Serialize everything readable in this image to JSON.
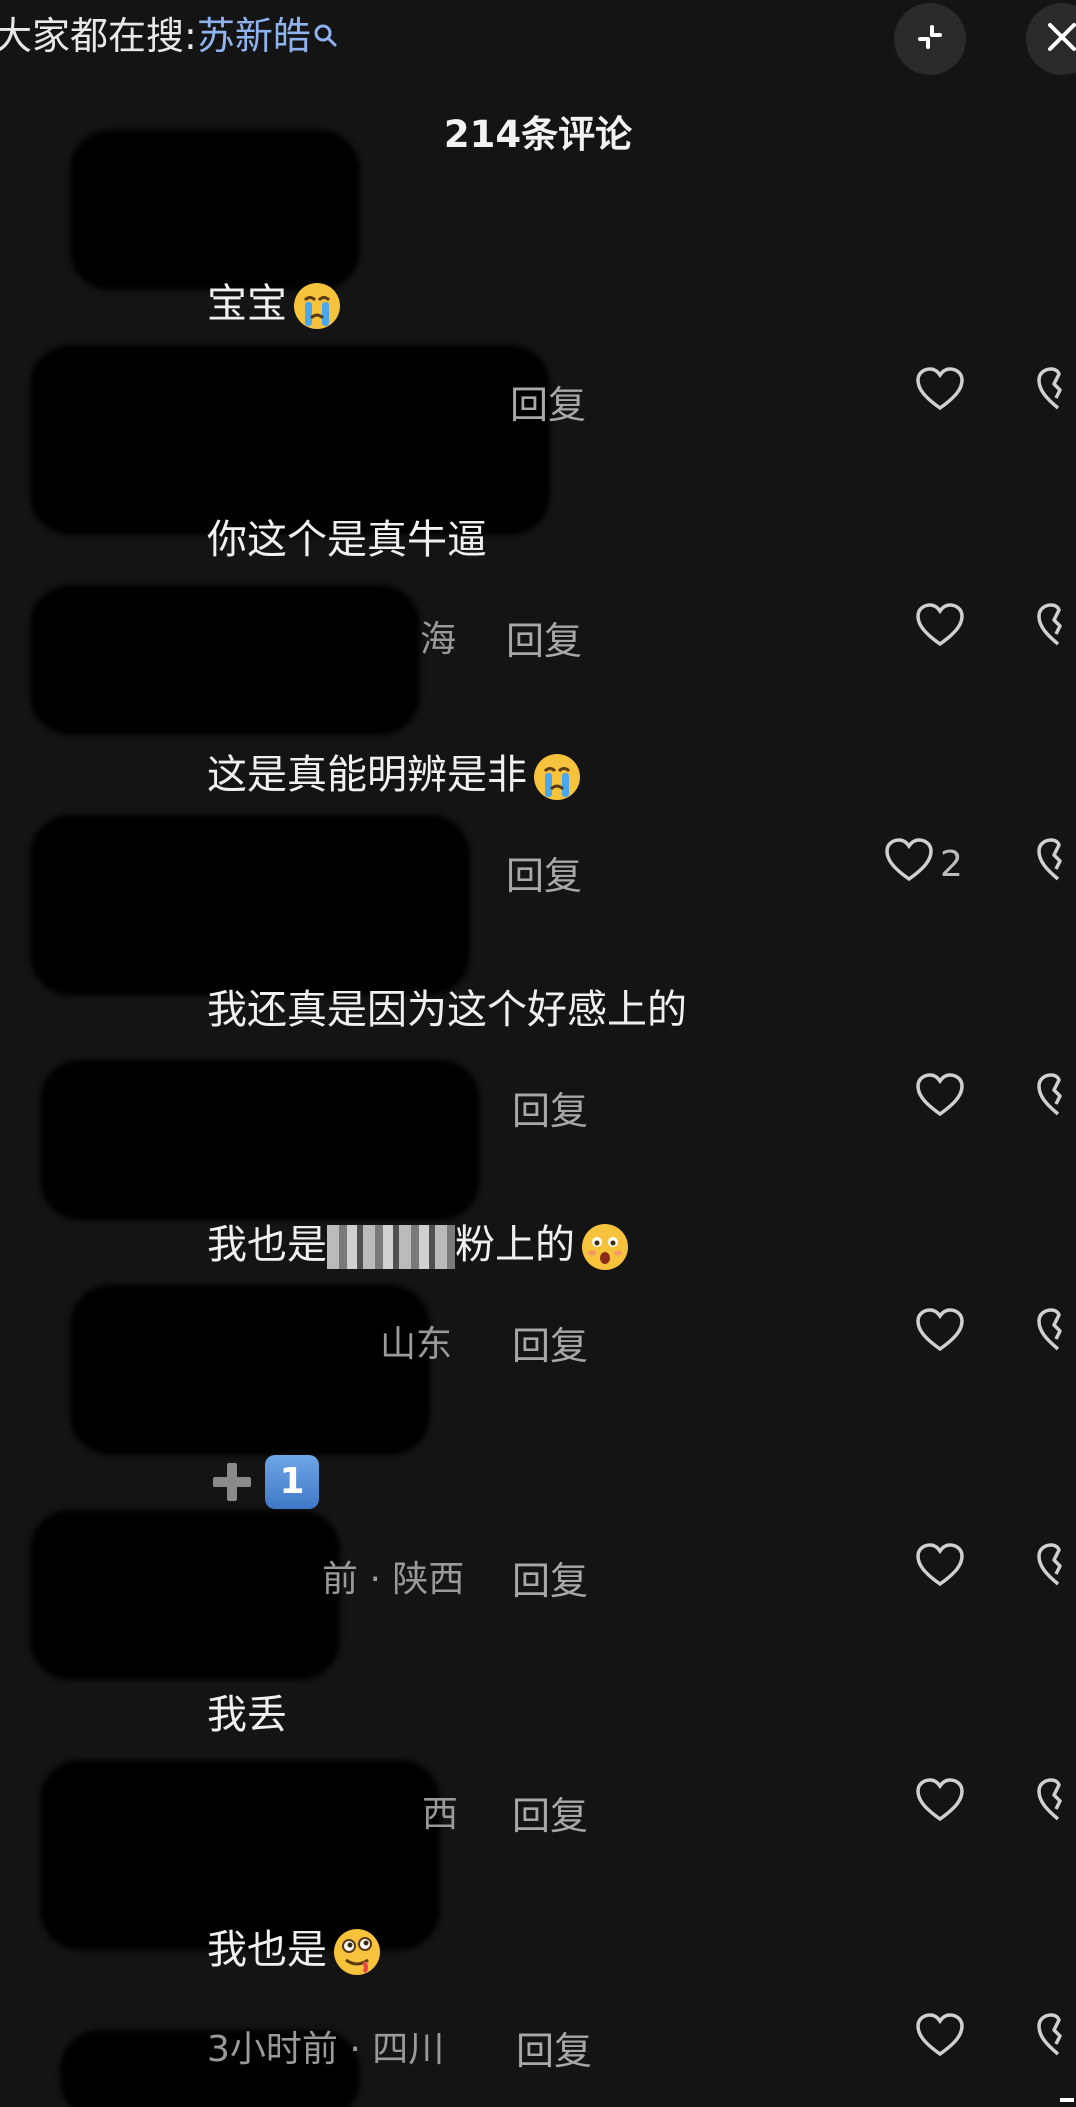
{
  "top_bar": {
    "search_prefix": "大家都在搜:",
    "search_term": "苏新皓",
    "search_icon": "magnifier-icon",
    "collapse_icon": "collapse-icon",
    "close_icon": "close-icon"
  },
  "comment_count_label": "214条评论",
  "reply_label": "回复",
  "comments": [
    {
      "text": "宝宝",
      "emoji": "crying-face-emoji",
      "meta": "",
      "likes": ""
    },
    {
      "text": "你这个是真牛逼",
      "meta": "海",
      "likes": ""
    },
    {
      "text": "这是真能明辨是非",
      "emoji": "crying-face-emoji",
      "meta": "",
      "likes": "2"
    },
    {
      "text": "我还真是因为这个好感上的",
      "meta": "",
      "likes": ""
    },
    {
      "text_before": "我也是",
      "text_after": "粉上的",
      "emoji": "astonished-face-emoji",
      "meta": "山东",
      "likes": ""
    },
    {
      "text": "",
      "emoji": "plus-one-emoji",
      "keycap": "1",
      "meta": "前 · 陕西",
      "likes": ""
    },
    {
      "text": "我丢",
      "meta": "西",
      "likes": ""
    },
    {
      "text": "我也是",
      "emoji": "drooling-face-emoji",
      "meta": "3小时前 · 四川",
      "likes": ""
    }
  ],
  "colors": {
    "background": "#141414",
    "search_term": "#8fb3f0",
    "secondary_text": "#9a9a9a"
  }
}
